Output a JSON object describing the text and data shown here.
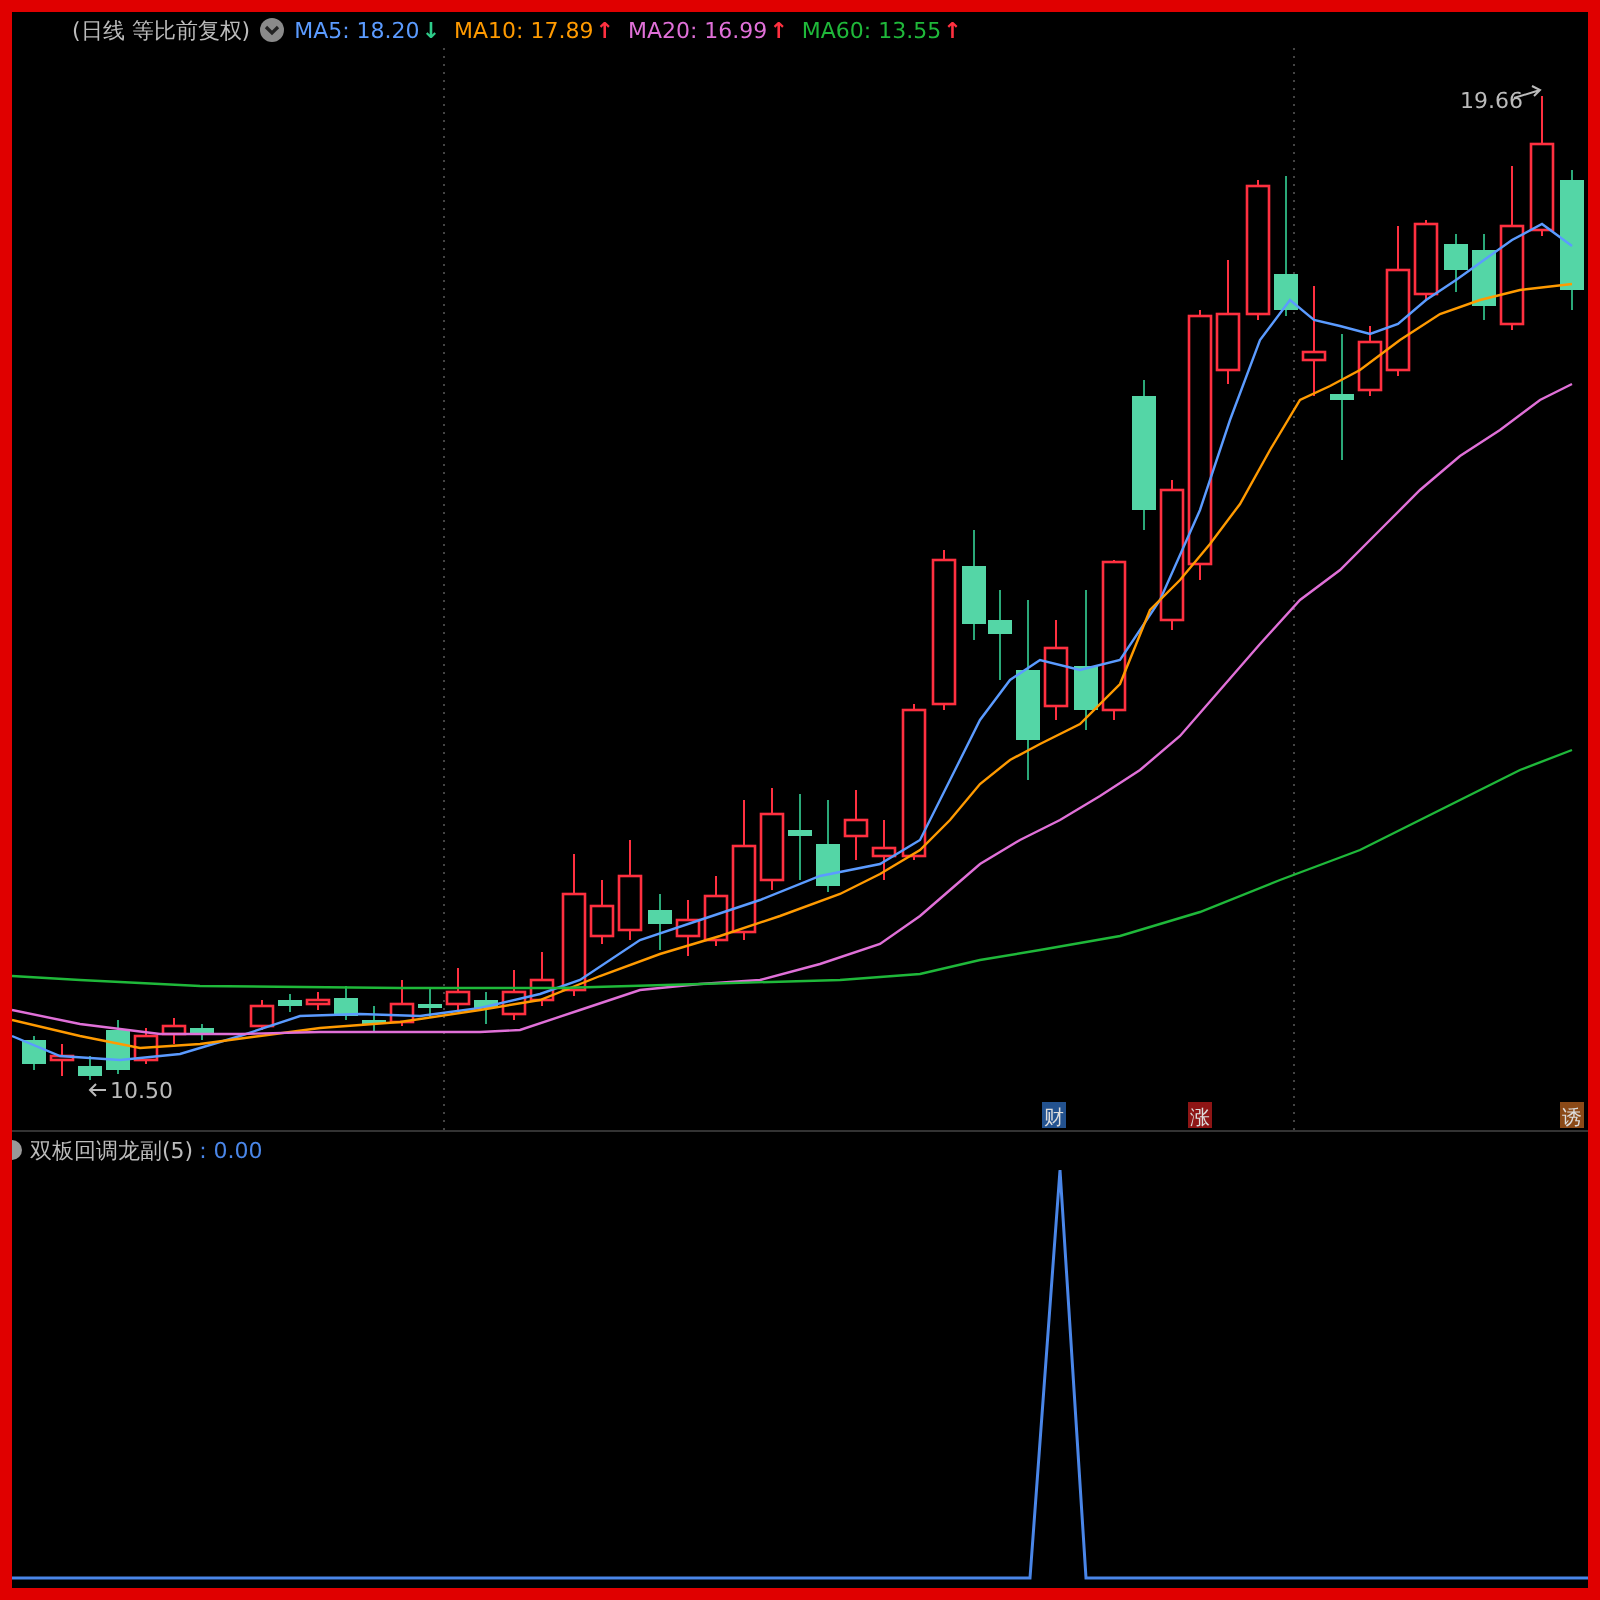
{
  "header": {
    "title": "(日线 等比前复权)",
    "moving_averages": [
      {
        "label": "MA5: 18.20",
        "trend": {
          "arrow": "↓",
          "color": "#2ecc8a"
        },
        "color": "#5b9bff"
      },
      {
        "label": "MA10: 17.89",
        "trend": {
          "arrow": "↑",
          "color": "#ff3040"
        },
        "color": "#ff9a00"
      },
      {
        "label": "MA20: 16.99",
        "trend": {
          "arrow": "↑",
          "color": "#ff3040"
        },
        "color": "#e070d8"
      },
      {
        "label": "MA60: 13.55",
        "trend": {
          "arrow": "↑",
          "color": "#ff3040"
        },
        "color": "#1fb83a"
      }
    ]
  },
  "main_chart": {
    "high_label": "19.66",
    "low_label": "10.50",
    "event_tags": [
      {
        "label": "财",
        "color": "#23528f"
      },
      {
        "label": "涨",
        "color": "#8e1515"
      },
      {
        "label": "诱",
        "color": "#8b4a18"
      }
    ]
  },
  "indicator": {
    "name": "双板回调龙副(5)",
    "value": ": 0.00"
  }
}
